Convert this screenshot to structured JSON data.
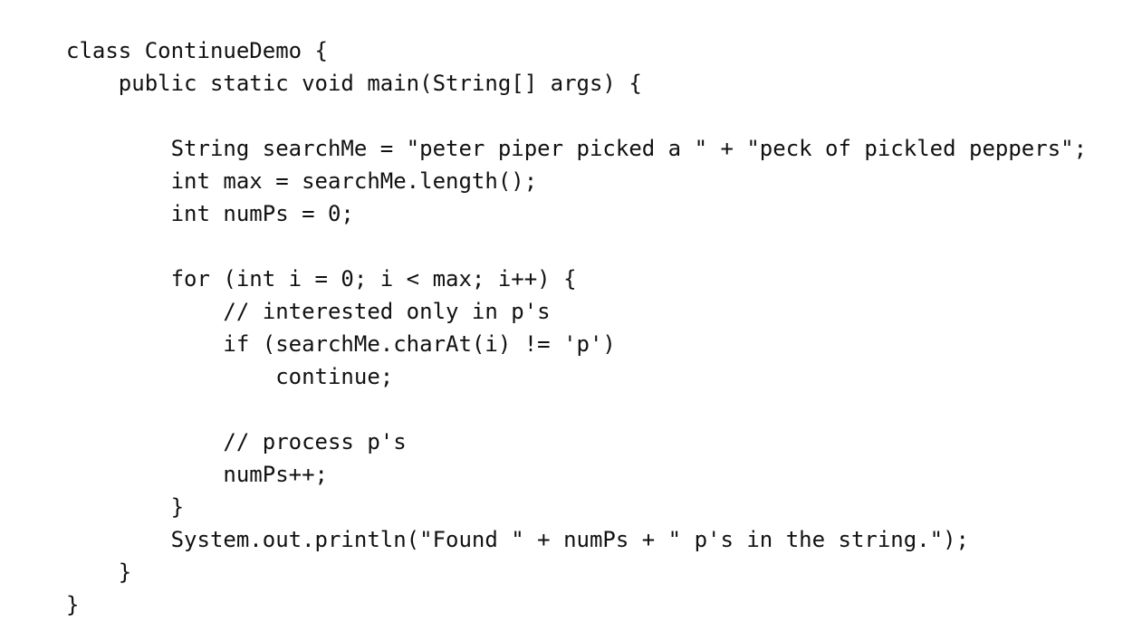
{
  "code": {
    "lines": [
      "class ContinueDemo {",
      "    public static void main(String[] args) {",
      "",
      "        String searchMe = \"peter piper picked a \" + \"peck of pickled peppers\";",
      "        int max = searchMe.length();",
      "        int numPs = 0;",
      "",
      "        for (int i = 0; i < max; i++) {",
      "            // interested only in p's",
      "            if (searchMe.charAt(i) != 'p')",
      "                continue;",
      "",
      "            // process p's",
      "            numPs++;",
      "        }",
      "        System.out.println(\"Found \" + numPs + \" p's in the string.\");",
      "    }",
      "}"
    ]
  }
}
